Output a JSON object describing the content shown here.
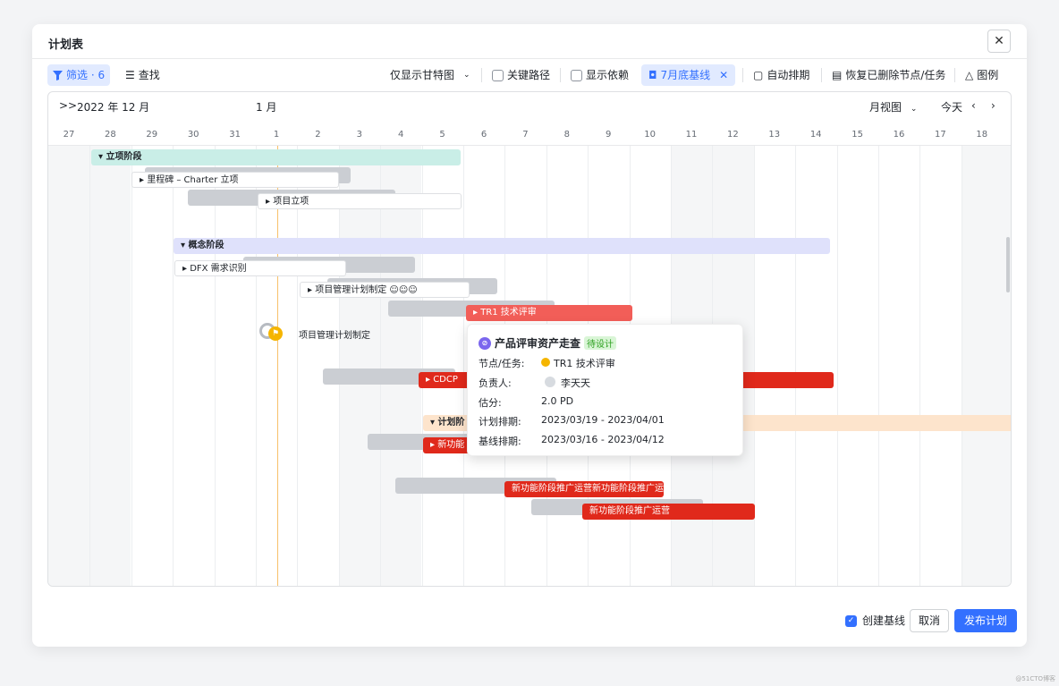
{
  "dialog": {
    "title": "计划表",
    "close_glyph": "✕"
  },
  "toolbar": {
    "filter_label": "筛选 · 6",
    "find_label": "查找",
    "gantt_only_label": "仅显示甘特图",
    "critical_path_label": "关键路径",
    "show_deps_label": "显示依赖",
    "baseline_label": "7月底基线",
    "auto_schedule_label": "自动排期",
    "restore_label": "恢复已删除节点/任务",
    "legend_label": "图例"
  },
  "timeline": {
    "month_current": "2022 年 12 月",
    "month_next": "1 月",
    "view_label": "月视图",
    "today_label": "今天",
    "prev_glyph": "‹",
    "next_glyph": "›",
    "expand_glyph": ">>",
    "days": [
      "27",
      "28",
      "29",
      "30",
      "31",
      "1",
      "2",
      "3",
      "4",
      "5",
      "6",
      "7",
      "8",
      "9",
      "10",
      "11",
      "12",
      "13",
      "14",
      "15",
      "16",
      "17",
      "18"
    ]
  },
  "tasks": {
    "phase1": "立项阶段",
    "milestone": "里程碑 – Charter 立项",
    "project_init": "项目立项",
    "phase2": "概念阶段",
    "dfx": "DFX 需求识别",
    "pm_plan": "项目管理计划制定",
    "tr1": "TR1 技术评审",
    "pm_plan_node": "项目管理计划制定",
    "cdcp": "CDCP",
    "phase3": "计划阶",
    "new_func": "新功能",
    "promo_long": "新功能阶段推广运营新功能阶段推广运...",
    "promo": "新功能阶段推广运营"
  },
  "tooltip": {
    "title": "产品评审资产走查",
    "status": "待设计",
    "node_key": "节点/任务:",
    "node_val": "TR1 技术评审",
    "owner_key": "负责人:",
    "owner_val": "李天天",
    "estimate_key": "估分:",
    "estimate_val": "2.0 PD",
    "plan_key": "计划排期:",
    "plan_val": "2023/03/19 - 2023/04/01",
    "baseline_key": "基线排期:",
    "baseline_val": "2023/03/16 - 2023/04/12"
  },
  "footer": {
    "create_baseline": "创建基线",
    "cancel": "取消",
    "publish": "发布计划"
  },
  "watermark": "@51CTO博客",
  "colors": {
    "primary": "#3370ff",
    "red": "#e0291b",
    "teal": "#c9eee7",
    "lavender": "#dfe1fb",
    "peach": "#fde4cc"
  }
}
